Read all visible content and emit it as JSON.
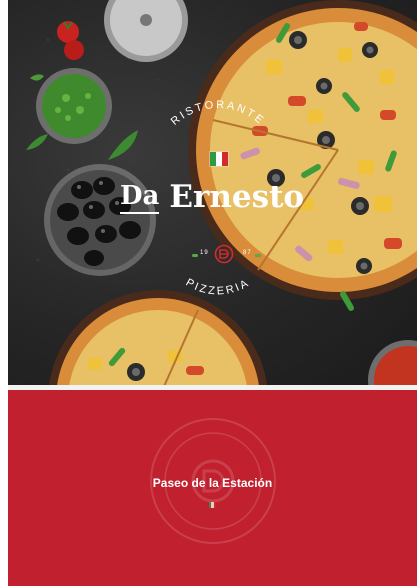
{
  "brand": {
    "top_text": "RISTORANTE",
    "bottom_text": "PIZZERIA",
    "title_prefix": "Da",
    "title_name": "Ernesto",
    "year_left": "19",
    "year_right": "87"
  },
  "location": {
    "name": "Paseo de la Estación"
  },
  "colors": {
    "brand_red": "#c1202e",
    "flag_green": "#2e9a47",
    "flag_white": "#ffffff",
    "flag_red": "#d22b2b"
  },
  "icons": [
    "italian-flag-icon",
    "monogram-icon",
    "logo-watermark-icon"
  ]
}
